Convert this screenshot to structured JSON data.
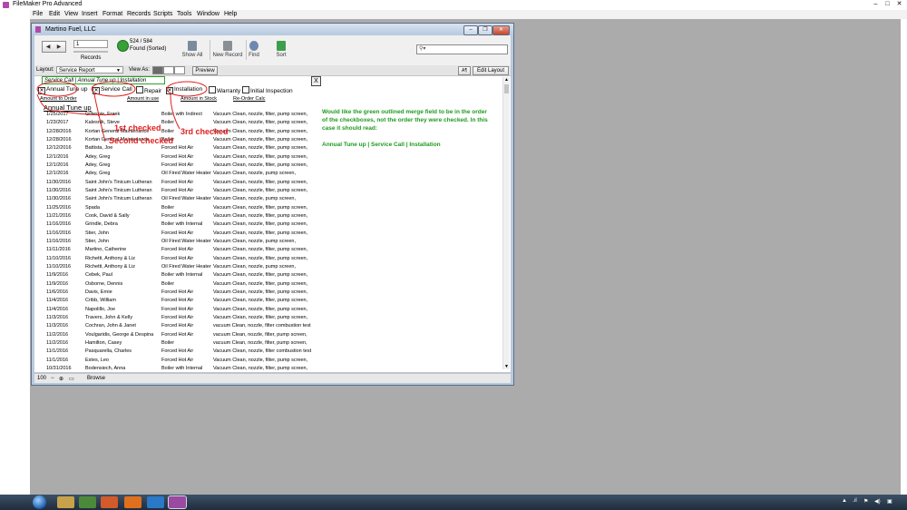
{
  "app": {
    "title": "FileMaker Pro Advanced"
  },
  "menu": [
    "File",
    "Edit",
    "View",
    "Insert",
    "Format",
    "Records",
    "Scripts",
    "Tools",
    "Window",
    "Help"
  ],
  "window": {
    "title": "Martino Fuel, LLC"
  },
  "toolbar": {
    "record_field": "1",
    "records_label": "Records",
    "found_count": "524 / 584",
    "found_status": "Found (Sorted)",
    "show_all": "Show All",
    "new_record": "New Record",
    "find": "Find",
    "sort": "Sort"
  },
  "layout_bar": {
    "layout_label": "Layout:",
    "layout_value": "Service Report",
    "view_as": "View As:",
    "preview": "Preview",
    "aa": "A¶",
    "edit_layout": "Edit Layout"
  },
  "form": {
    "merge_field": "Service Call | Annual Tune up | Installation",
    "close_x": "X",
    "checkboxes": [
      {
        "label": "Annual Tune up",
        "checked": true
      },
      {
        "label": "Service Call",
        "checked": true
      },
      {
        "label": "Repair",
        "checked": false
      },
      {
        "label": "Installation",
        "checked": true
      },
      {
        "label": "Warranty",
        "checked": false
      },
      {
        "label": "Initial Inspection",
        "checked": false
      }
    ],
    "links": [
      "Amount to Order",
      "Amount in use",
      "Amount in Stock",
      "Re-Order Calc"
    ],
    "section_title": "Annual Tune up",
    "annotations": {
      "first": "1st checked",
      "second": "Second checked",
      "third": "3rd checked"
    },
    "note": "Would like the green outlined merge field to be in the order of the checkboxes, not the order they were checked.  In this case it should read:",
    "note_example": "Annual Tune up | Service Call | Installation"
  },
  "rows": [
    [
      "1/25/2017",
      "Gillespie, Frank",
      "Boiler with Indirect",
      "Vacuum Clean, nozzle, filter, pump screen,"
    ],
    [
      "1/23/2017",
      "Kalesnik, Steve",
      "Boiler",
      "Vacuum Clean, nozzle, filter, pump screen,"
    ],
    [
      "12/28/2016",
      "Kortan General Maintenance",
      "Boiler",
      "Vacuum Clean, nozzle, filter, pump screen,"
    ],
    [
      "12/28/2016",
      "Kortan General Maintenance",
      "Boiler",
      "Vacuum Clean, nozzle, filter, pump screen,"
    ],
    [
      "12/12/2016",
      "Battista, Joe",
      "Forced Hot Air",
      "Vacuum Clean, nozzle, filter, pump screen,"
    ],
    [
      "12/1/2016",
      "Adey, Greg",
      "Forced Hot Air",
      "Vacuum Clean, nozzle, filter, pump screen,"
    ],
    [
      "12/1/2016",
      "Adey, Greg",
      "Forced Hot Air",
      "Vacuum Clean, nozzle, filter, pump screen,"
    ],
    [
      "12/1/2016",
      "Adey, Greg",
      "Oil Fired Water Heater",
      "Vacuum Clean, nozzle, pump screen,"
    ],
    [
      "11/30/2016",
      "Saint John's Tinicum Lutheran",
      "Forced Hot Air",
      "Vacuum Clean, nozzle, filter, pump screen,"
    ],
    [
      "11/30/2016",
      "Saint John's Tinicum Lutheran",
      "Forced Hot Air",
      "Vacuum Clean, nozzle, filter, pump screen,"
    ],
    [
      "11/30/2016",
      "Saint John's Tinicum Lutheran",
      "Oil Fired Water Heater",
      "Vacuum Clean, nozzle, pump screen,"
    ],
    [
      "11/25/2016",
      "Spada",
      "Boiler",
      "Vacuum Clean, nozzle, filter, pump screen,"
    ],
    [
      "11/21/2016",
      "Cook, David & Sally",
      "Forced Hot Air",
      "Vacuum Clean, nozzle, filter, pump screen,"
    ],
    [
      "11/16/2016",
      "Grindle, Debra",
      "Boiler with Internal",
      "Vacuum Clean, nozzle, filter, pump screen,"
    ],
    [
      "11/16/2016",
      "Stier, John",
      "Forced Hot Air",
      "Vacuum Clean, nozzle, filter, pump screen,"
    ],
    [
      "11/16/2016",
      "Stier, John",
      "Oil Fired Water Heater",
      "Vacuum Clean, nozzle, pump screen,"
    ],
    [
      "11/11/2016",
      "Martino, Catherine",
      "Forced Hot Air",
      "Vacuum Clean, nozzle, filter, pump screen,"
    ],
    [
      "11/10/2016",
      "Richetti, Anthony & Liz",
      "Forced Hot Air",
      "Vacuum Clean, nozzle, filter, pump screen,"
    ],
    [
      "11/10/2016",
      "Richetti, Anthony & Liz",
      "Oil Fired Water Heater",
      "Vacuum Clean, nozzle, pump screen,"
    ],
    [
      "11/9/2016",
      "Cebek, Paul",
      "Boiler with Internal",
      "Vacuum Clean, nozzle, filter, pump screen,"
    ],
    [
      "11/9/2016",
      "Osborne, Dennis",
      "Boiler",
      "Vacuum Clean, nozzle, filter, pump screen,"
    ],
    [
      "11/6/2016",
      "Davis, Ernie",
      "Forced Hot Air",
      "Vacuum Clean, nozzle, filter, pump screen,"
    ],
    [
      "11/4/2016",
      "Cribb, William",
      "Forced Hot Air",
      "Vacuum Clean, nozzle, filter, pump screen,"
    ],
    [
      "11/4/2016",
      "Napolillo, Joe",
      "Forced Hot Air",
      "Vacuum Clean, nozzle, filter, pump screen,"
    ],
    [
      "11/3/2016",
      "Travers, John & Kelly",
      "Forced Hot Air",
      "Vacuum Clean, nozzle, filter, pump screen,"
    ],
    [
      "11/3/2016",
      "Cochran, John & Janet",
      "Forced Hot Air",
      "vacuum Clean, nozzle, filter combustion test"
    ],
    [
      "11/2/2016",
      "Voulgaridis, George & Despina",
      "Forced Hot Air",
      "vacuum Clean, nozzle, filter, pump screen,"
    ],
    [
      "11/2/2016",
      "Hamilton, Casey",
      "Boiler",
      "vacuum Clean, nozzle, filter, pump screen,"
    ],
    [
      "11/1/2016",
      "Pasquarella, Charles",
      "Forced Hot Air",
      "Vacuum Clean, nozzle, filter combustion test"
    ],
    [
      "11/1/2016",
      "Estes, Leo",
      "Forced Hot Air",
      "Vacuum Clean, nozzle, filter, pump screen,"
    ],
    [
      "10/31/2016",
      "Bodensiech, Anna",
      "Boiler with Internal",
      "Vacuum Clean, nozzle, filter, pump screen,"
    ]
  ],
  "status": {
    "zoom": "100",
    "mode": "Browse"
  }
}
